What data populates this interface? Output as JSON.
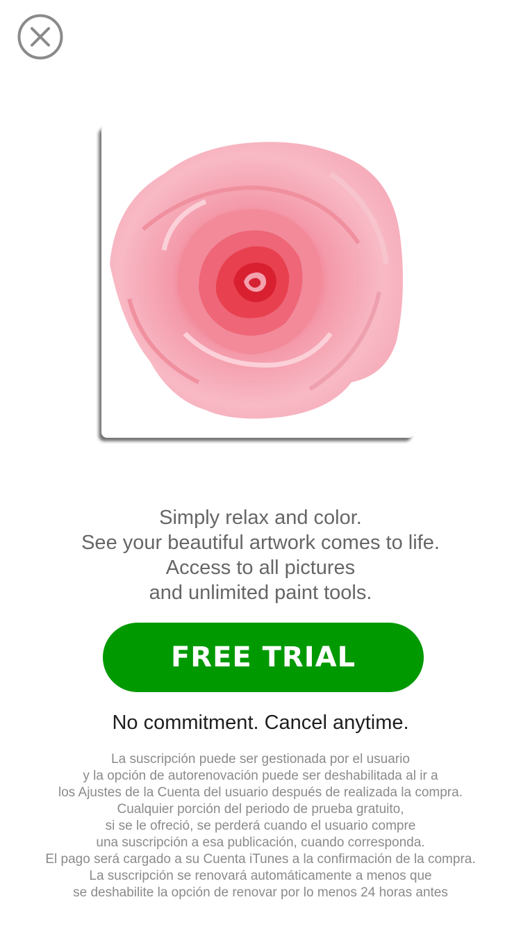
{
  "close": {
    "icon": "close-circle-icon"
  },
  "artwork": {
    "subject": "pixel-art-pink-rose",
    "colors": {
      "petal": "#f4a6b4",
      "center": "#e0283a"
    }
  },
  "promo": {
    "lines": [
      "Simply relax and color.",
      "See your beautiful artwork comes to life.",
      "Access to all pictures",
      "and unlimited paint tools."
    ]
  },
  "cta": {
    "label": "FREE TRIAL",
    "color": "#009900"
  },
  "commitment": "No commitment. Cancel anytime.",
  "legal": {
    "lines": [
      "La suscripción puede ser gestionada por el usuario",
      "y la opción de autorenovación puede ser deshabilitada al ir a",
      "los Ajustes de la Cuenta del usuario después de realizada la compra.",
      "Cualquier porción del periodo de prueba gratuito,",
      "si se le ofreció, se perderá cuando el usuario compre",
      "una suscripción a esa publicación, cuando corresponda.",
      "El pago será cargado a su Cuenta iTunes a la confirmación de la compra.",
      "La suscripción se renovará automáticamente a menos que",
      "se deshabilite la opción de renovar por lo menos 24 horas antes"
    ]
  }
}
